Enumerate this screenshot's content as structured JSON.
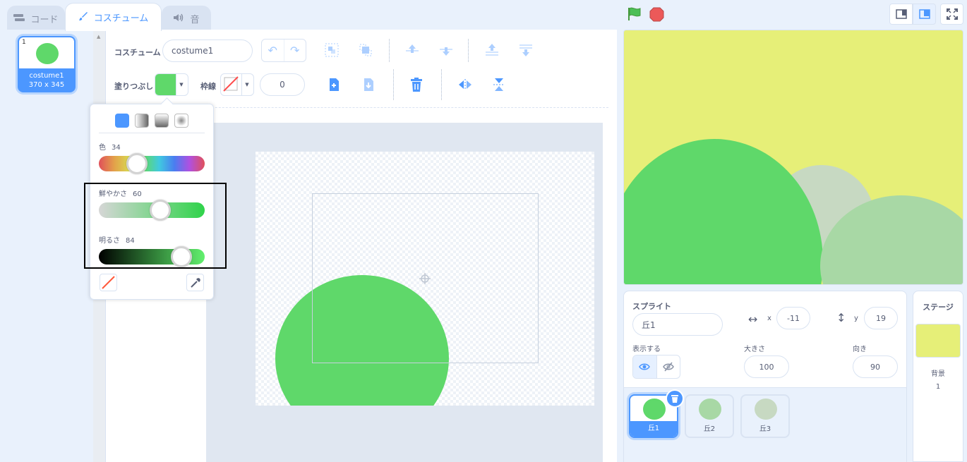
{
  "tabs": [
    {
      "label": "コード",
      "icon": "code-icon"
    },
    {
      "label": "コスチューム",
      "icon": "brush-icon"
    },
    {
      "label": "音",
      "icon": "speaker-icon"
    }
  ],
  "costume_list": {
    "items": [
      {
        "number": "1",
        "name": "costume1",
        "size": "370 x 345"
      }
    ]
  },
  "toolbar": {
    "costume_label": "コスチューム",
    "costume_name": "costume1",
    "fill_label": "塗りつぶし",
    "outline_label": "枠線",
    "outline_width": "0",
    "fill_color": "#5fd86a"
  },
  "color_picker": {
    "color_label": "色",
    "color_value": "34",
    "saturation_label": "鮮やかさ",
    "saturation_value": "60",
    "brightness_label": "明るさ",
    "brightness_value": "84"
  },
  "sprite_info": {
    "title": "スプライト",
    "name": "丘1",
    "x_label": "x",
    "x_value": "-11",
    "y_label": "y",
    "y_value": "19",
    "show_label": "表示する",
    "size_label": "大きさ",
    "size_value": "100",
    "direction_label": "向き",
    "direction_value": "90"
  },
  "sprites": [
    {
      "name": "丘1",
      "selected": true
    },
    {
      "name": "丘2",
      "selected": false
    },
    {
      "name": "丘3",
      "selected": false
    }
  ],
  "stage_panel": {
    "title": "ステージ",
    "backdrop_label": "背景",
    "backdrop_count": "1"
  },
  "colors": {
    "accent": "#4c97ff",
    "stage_bg": "#e6ef78",
    "hill1": "#5fd86a",
    "hill2": "#c7d9c2",
    "hill3": "#a8d8a5"
  }
}
